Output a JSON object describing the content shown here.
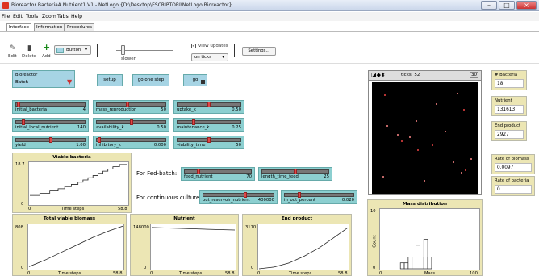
{
  "window": {
    "title": "Bioreactor BacteriaA Nutrient1 V1 - NetLogo {D:\\Desktop\\ESCRIPTORI\\NetLogo Bioreactor}"
  },
  "menu": {
    "items": [
      "File",
      "Edit",
      "Tools",
      "Zoom",
      "Tabs",
      "Help"
    ]
  },
  "tabs": [
    "Interface",
    "Information",
    "Procedures"
  ],
  "toolbar": {
    "edit": "Edit",
    "delete": "Delete",
    "add": "Add",
    "widget_type": "Button",
    "speed": "slower",
    "view_updates": "view updates",
    "update_mode": "on ticks",
    "settings": "Settings..."
  },
  "chooser": {
    "label": "Bioreactor",
    "value": "Batch"
  },
  "buttons": {
    "setup": "setup",
    "go_once": "go one step",
    "go": "go"
  },
  "sliders": [
    {
      "name": "initial_bacteria",
      "value": "4",
      "fraction": 0.03
    },
    {
      "name": "mass_reproduction",
      "value": "50",
      "fraction": 0.45
    },
    {
      "name": "uptake_k",
      "value": "0.50",
      "fraction": 0.5
    },
    {
      "name": "initial_local_nutrient",
      "value": "140",
      "fraction": 0.1
    },
    {
      "name": "availability_k",
      "value": "0.50",
      "fraction": 0.5
    },
    {
      "name": "maintenance_k",
      "value": "0.25",
      "fraction": 0.25
    },
    {
      "name": "yield",
      "value": "1.00",
      "fraction": 0.5
    },
    {
      "name": "inhibitory_k",
      "value": "0.000",
      "fraction": 0.03
    },
    {
      "name": "viability_time",
      "value": "50",
      "fraction": 0.5
    }
  ],
  "fedbatch": {
    "label": "For Fed-batch:",
    "feed_nutrient": {
      "name": "feed_nutrient",
      "value": "70",
      "fraction": 0.2
    },
    "length_time_feed": {
      "name": "length_time_feed",
      "value": "25",
      "fraction": 0.5
    }
  },
  "continuous": {
    "label": "For continuous culture:",
    "out_reservoir": {
      "name": "out_reservoir_nutrient",
      "value": "400000",
      "fraction": 0.6
    },
    "in_out_percent": {
      "name": "in_out_percent",
      "value": "0.020",
      "fraction": 0.2
    }
  },
  "view": {
    "ticks_label": "ticks: 52",
    "speed_label": "30"
  },
  "monitors": [
    {
      "label": "# Bacteria",
      "value": "18"
    },
    {
      "label": "Nutrient",
      "value": "131613"
    },
    {
      "label": "End product",
      "value": "2927"
    },
    {
      "label": "Rate of biomass",
      "value": "0.0097"
    },
    {
      "label": "Rate of bacteria",
      "value": "0"
    }
  ],
  "chart_data": [
    {
      "type": "line",
      "title": "Viable bacteria",
      "xlabel": "Time steps",
      "ylabel": "",
      "ylim": [
        0,
        18.7
      ],
      "xlim": [
        0,
        58.8
      ],
      "series": [
        {
          "values": [
            [
              0,
              4
            ],
            [
              6,
              4
            ],
            [
              6,
              5
            ],
            [
              12,
              5
            ],
            [
              12,
              6
            ],
            [
              17,
              6
            ],
            [
              17,
              7
            ],
            [
              21,
              7
            ],
            [
              21,
              8
            ],
            [
              25,
              8
            ],
            [
              25,
              9
            ],
            [
              29,
              9
            ],
            [
              29,
              10
            ],
            [
              32,
              10
            ],
            [
              32,
              11
            ],
            [
              35,
              11
            ],
            [
              35,
              12
            ],
            [
              38,
              12
            ],
            [
              38,
              13
            ],
            [
              41,
              13
            ],
            [
              41,
              14
            ],
            [
              44,
              14
            ],
            [
              44,
              15
            ],
            [
              47,
              15
            ],
            [
              47,
              16
            ],
            [
              50,
              16
            ],
            [
              50,
              17
            ],
            [
              54,
              17
            ],
            [
              54,
              18
            ],
            [
              58.8,
              18
            ]
          ]
        }
      ]
    },
    {
      "type": "line",
      "title": "Total viable biomass",
      "xlabel": "Time steps",
      "ylabel": "",
      "ylim": [
        0,
        808
      ],
      "xlim": [
        0,
        58.8
      ],
      "series": [
        {
          "values": [
            [
              0,
              40
            ],
            [
              10,
              160
            ],
            [
              20,
              300
            ],
            [
              30,
              440
            ],
            [
              40,
              580
            ],
            [
              50,
              700
            ],
            [
              58.8,
              790
            ]
          ]
        }
      ]
    },
    {
      "type": "line",
      "title": "Nutrient",
      "xlabel": "Time steps",
      "ylabel": "",
      "ylim": [
        0,
        148000
      ],
      "xlim": [
        0,
        58.8
      ],
      "series": [
        {
          "values": [
            [
              0,
              140000
            ],
            [
              20,
              137000
            ],
            [
              40,
              134000
            ],
            [
              58.8,
              131613
            ]
          ]
        }
      ]
    },
    {
      "type": "line",
      "title": "End product",
      "xlabel": "Time steps",
      "ylabel": "",
      "ylim": [
        0,
        3110
      ],
      "xlim": [
        0,
        58.8
      ],
      "series": [
        {
          "values": [
            [
              0,
              0
            ],
            [
              10,
              120
            ],
            [
              20,
              420
            ],
            [
              30,
              900
            ],
            [
              40,
              1500
            ],
            [
              50,
              2250
            ],
            [
              58.8,
              2927
            ]
          ]
        }
      ]
    },
    {
      "type": "bar",
      "title": "Mass distribution",
      "xlabel": "Mass",
      "ylabel": "Count",
      "ylim": [
        0,
        10
      ],
      "xlim": [
        0,
        100
      ],
      "x": [
        20,
        24,
        28,
        32,
        36,
        40,
        44,
        48
      ],
      "values": [
        1,
        1,
        2,
        2,
        4,
        2,
        5,
        2
      ]
    }
  ],
  "agents": [
    [
      0.12,
      0.12
    ],
    [
      0.82,
      0.1
    ],
    [
      0.62,
      0.2
    ],
    [
      0.88,
      0.25
    ],
    [
      0.14,
      0.4
    ],
    [
      0.42,
      0.35
    ],
    [
      0.28,
      0.54
    ],
    [
      0.24,
      0.48
    ],
    [
      0.36,
      0.5
    ],
    [
      0.58,
      0.57
    ],
    [
      0.95,
      0.7
    ],
    [
      0.78,
      0.73
    ],
    [
      0.9,
      0.8
    ],
    [
      0.86,
      0.82
    ],
    [
      0.1,
      0.86
    ],
    [
      0.44,
      0.62
    ],
    [
      0.7,
      0.45
    ],
    [
      0.5,
      0.9
    ]
  ]
}
